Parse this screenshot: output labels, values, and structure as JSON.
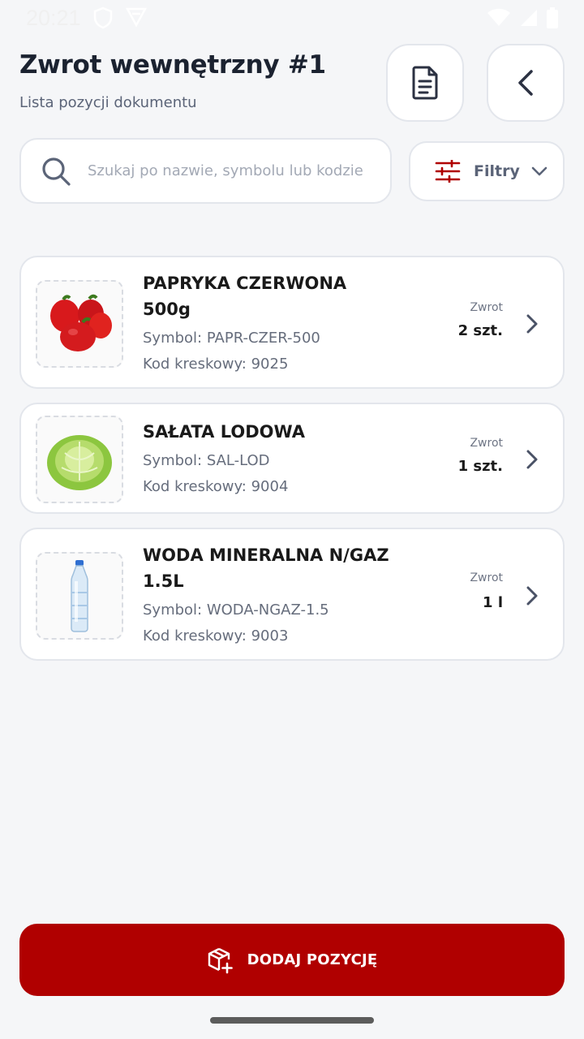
{
  "status_bar": {
    "time": "20:21"
  },
  "header": {
    "title": "Zwrot wewnętrzny #1",
    "subtitle": "Lista pozycji dokumentu"
  },
  "search": {
    "placeholder": "Szukaj po nazwie, symbolu lub kodzie"
  },
  "filter": {
    "label": "Filtry"
  },
  "items": [
    {
      "name_line1": "PAPRYKA CZERWONA",
      "name_line2": "500g",
      "symbol": "Symbol: PAPR-CZER-500",
      "barcode": "Kod kreskowy: 9025",
      "return_label": "Zwrot",
      "return_qty": "2 szt.",
      "image": "red-pepper"
    },
    {
      "name_line1": "SAŁATA LODOWA",
      "name_line2": "",
      "symbol": "Symbol: SAL-LOD",
      "barcode": "Kod kreskowy: 9004",
      "return_label": "Zwrot",
      "return_qty": "1 szt.",
      "image": "iceberg-lettuce"
    },
    {
      "name_line1": "WODA MINERALNA N/GAZ",
      "name_line2": "1.5L",
      "symbol": "Symbol: WODA-NGAZ-1.5",
      "barcode": "Kod kreskowy: 9003",
      "return_label": "Zwrot",
      "return_qty": "1 l",
      "image": "water-bottle"
    }
  ],
  "footer": {
    "add_button_label": "DODAJ POZYCJĘ"
  },
  "colors": {
    "accent": "#b00000",
    "background": "#f5f6f8",
    "card": "#ffffff"
  }
}
